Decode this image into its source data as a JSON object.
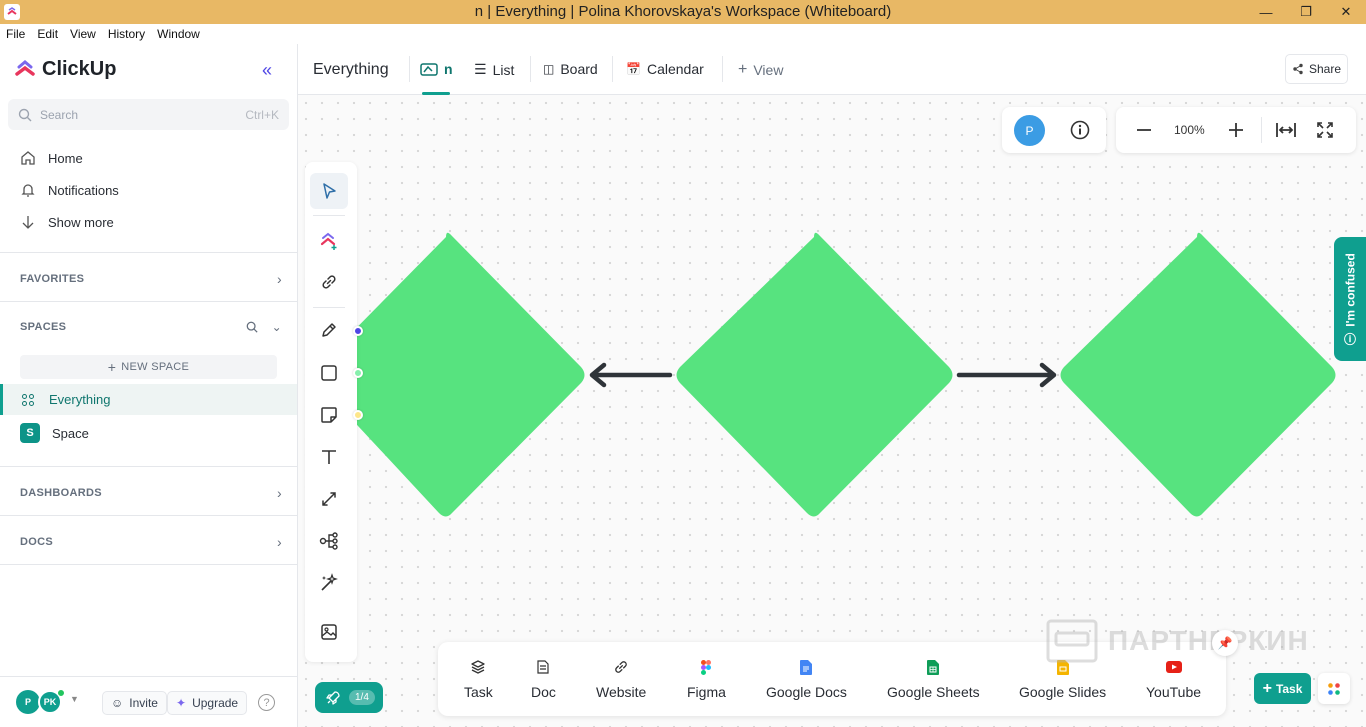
{
  "window": {
    "title": "n | Everything | Polina Khorovskaya's Workspace (Whiteboard)"
  },
  "menu": [
    "File",
    "Edit",
    "View",
    "History",
    "Window"
  ],
  "sidebar": {
    "brand": "ClickUp",
    "search": {
      "placeholder": "Search",
      "shortcut": "Ctrl+K"
    },
    "nav": {
      "home": "Home",
      "notifications": "Notifications",
      "show_more": "Show more"
    },
    "favorites": "FAVORITES",
    "spaces": "SPACES",
    "new_space": "NEW SPACE",
    "everything": "Everything",
    "space": {
      "badge": "S",
      "label": "Space"
    },
    "dashboards": "DASHBOARDS",
    "docs": "DOCS",
    "footer": {
      "avatar1": "P",
      "avatar2": "PK",
      "invite": "Invite",
      "upgrade": "Upgrade"
    }
  },
  "header": {
    "title": "Everything",
    "tabs": {
      "whiteboard": "n",
      "list": "List",
      "board": "Board",
      "calendar": "Calendar",
      "view": "View"
    },
    "share": "Share"
  },
  "canvas_controls": {
    "user_avatar": "P",
    "zoom": "100%"
  },
  "embeds": {
    "task": "Task",
    "doc": "Doc",
    "website": "Website",
    "figma": "Figma",
    "google_docs": "Google Docs",
    "google_sheets": "Google Sheets",
    "google_slides": "Google Slides",
    "youtube": "YouTube"
  },
  "onboarding": {
    "progress": "1/4"
  },
  "confused": "I'm confused",
  "task_button": "Task",
  "watermark": "ПАРТНЕРКИН",
  "colors": {
    "accent": "#0f9f8f",
    "shape": "#57e37f",
    "arrow": "#2f3439"
  }
}
